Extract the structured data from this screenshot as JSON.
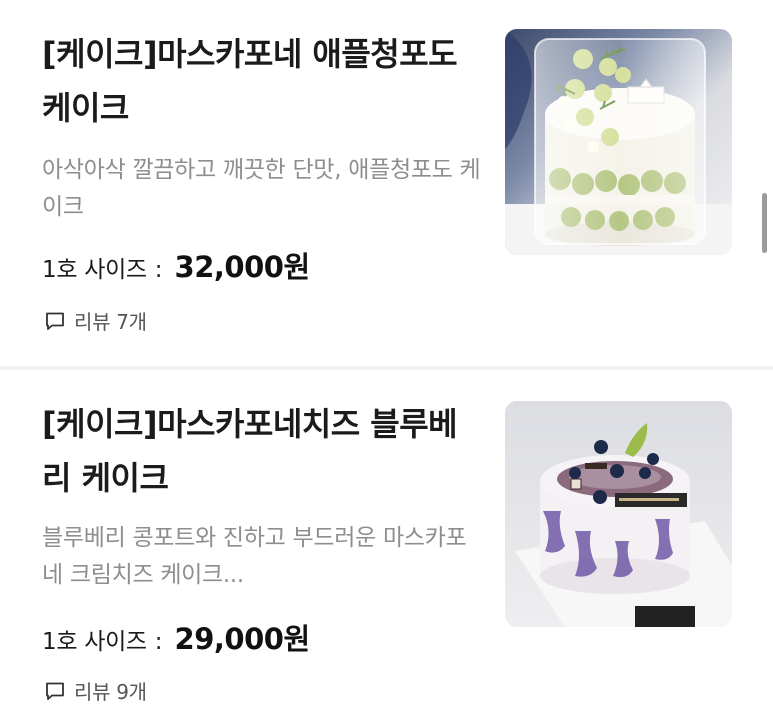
{
  "products": [
    {
      "title": "[케이크]마스카포네 애플청포도 케이크",
      "description": "아삭아삭 깔끔하고 깨끗한 단맛, 애플청포도 케이크",
      "price_label": "1호 사이즈",
      "price_colon": ":",
      "price": "32,000원",
      "review_label": "리뷰 7개",
      "image_icon": "green-grape-cake-photo"
    },
    {
      "title": "[케이크]마스카포네치즈 블루베리 케이크",
      "description": "블루베리 콩포트와 진하고 부드러운 마스카포네 크림치즈 케이크...",
      "price_label": "1호 사이즈",
      "price_colon": ":",
      "price": "29,000원",
      "review_label": "리뷰 9개",
      "image_icon": "blueberry-cake-photo"
    }
  ],
  "colors": {
    "title": "#1b1b1b",
    "description": "#8e8e8e",
    "divider": "#f2f2f2"
  }
}
